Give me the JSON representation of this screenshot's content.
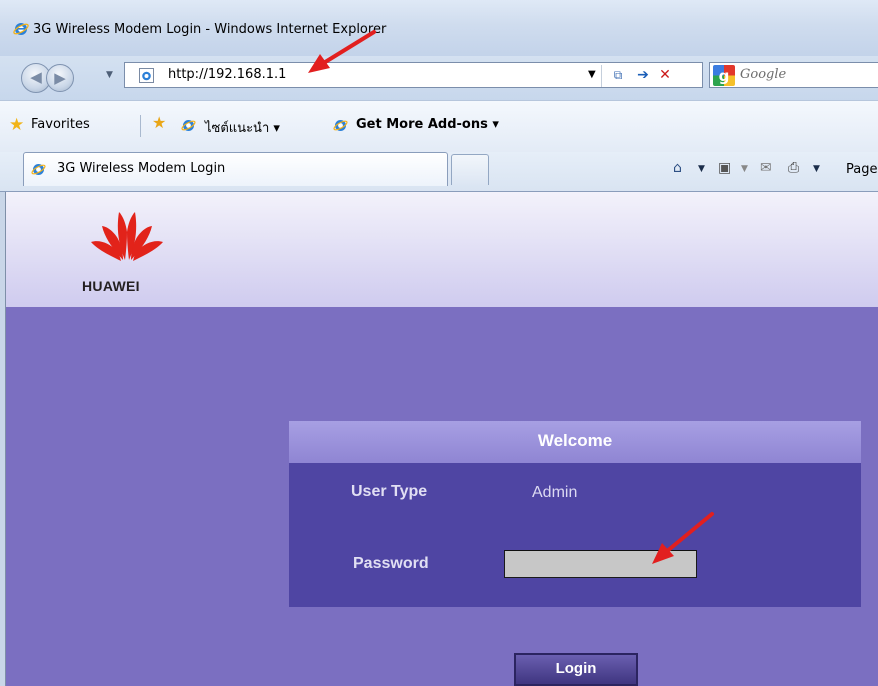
{
  "window": {
    "title": "3G Wireless Modem Login - Windows Internet Explorer"
  },
  "address_bar": {
    "url": "http://192.168.1.1"
  },
  "search_box": {
    "placeholder": "Google"
  },
  "favorites_bar": {
    "favorites_label": "Favorites",
    "link_suggested_sites": "ไซต์แนะนำ ▾",
    "link_addons": "Get More Add-ons ▾"
  },
  "tabs": [
    {
      "label": "3G Wireless Modem Login"
    }
  ],
  "command_bar": {
    "page_label": "Page"
  },
  "page": {
    "logo_text": "HUAWEI",
    "panel_title": "Welcome",
    "user_type_label": "User Type",
    "user_type_value": "Admin",
    "password_label": "Password",
    "login_button": "Login"
  },
  "colors": {
    "page_background": "#7b6fc1",
    "panel_header": "#9a91da",
    "panel_body": "#4f45a3",
    "annotation_arrow": "#e21f1f",
    "huawei_red": "#e2231a"
  }
}
